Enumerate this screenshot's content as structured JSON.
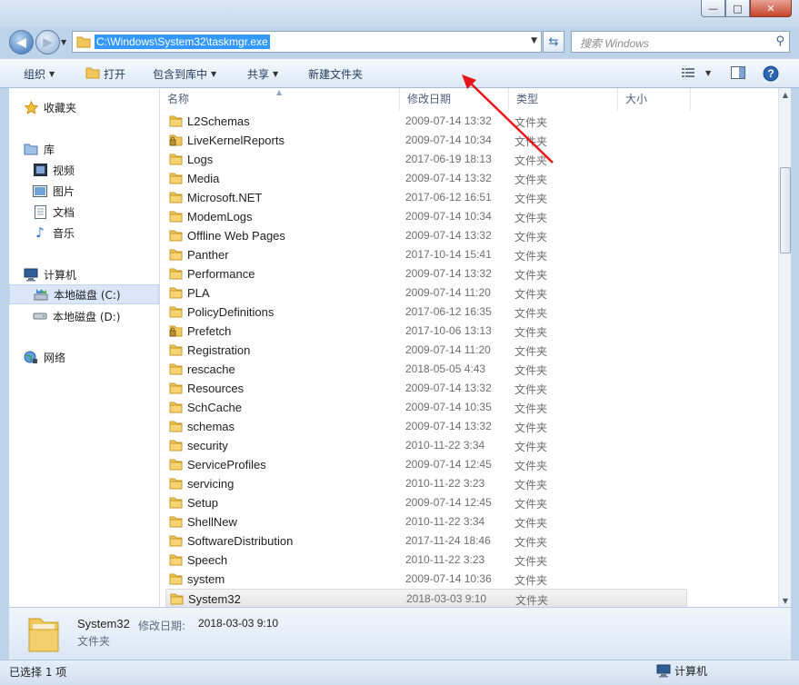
{
  "window": {
    "title_buttons": {
      "minimize": "—",
      "maximize": "□",
      "close": "✕"
    }
  },
  "address": {
    "path": "C:\\Windows\\System32\\taskmgr.exe",
    "search_placeholder": "搜索 Windows"
  },
  "toolbar": {
    "organize": "组织",
    "open": "打开",
    "include_library": "包含到库中",
    "share": "共享",
    "new_folder": "新建文件夹"
  },
  "nav": {
    "favorites": "收藏夹",
    "libraries": "库",
    "videos": "视频",
    "pictures": "图片",
    "documents": "文档",
    "music": "音乐",
    "computer": "计算机",
    "local_c": "本地磁盘 (C:)",
    "local_d": "本地磁盘 (D:)",
    "network": "网络"
  },
  "columns": {
    "name": "名称",
    "modified": "修改日期",
    "type": "类型",
    "size": "大小"
  },
  "files": [
    {
      "name": "L2Schemas",
      "date": "2009-07-14 13:32",
      "type": "文件夹",
      "locked": false
    },
    {
      "name": "LiveKernelReports",
      "date": "2009-07-14 10:34",
      "type": "文件夹",
      "locked": true
    },
    {
      "name": "Logs",
      "date": "2017-06-19 18:13",
      "type": "文件夹",
      "locked": false
    },
    {
      "name": "Media",
      "date": "2009-07-14 13:32",
      "type": "文件夹",
      "locked": false
    },
    {
      "name": "Microsoft.NET",
      "date": "2017-06-12 16:51",
      "type": "文件夹",
      "locked": false
    },
    {
      "name": "ModemLogs",
      "date": "2009-07-14 10:34",
      "type": "文件夹",
      "locked": false
    },
    {
      "name": "Offline Web Pages",
      "date": "2009-07-14 13:32",
      "type": "文件夹",
      "locked": false
    },
    {
      "name": "Panther",
      "date": "2017-10-14 15:41",
      "type": "文件夹",
      "locked": false
    },
    {
      "name": "Performance",
      "date": "2009-07-14 13:32",
      "type": "文件夹",
      "locked": false
    },
    {
      "name": "PLA",
      "date": "2009-07-14 11:20",
      "type": "文件夹",
      "locked": false
    },
    {
      "name": "PolicyDefinitions",
      "date": "2017-06-12 16:35",
      "type": "文件夹",
      "locked": false
    },
    {
      "name": "Prefetch",
      "date": "2017-10-06 13:13",
      "type": "文件夹",
      "locked": true
    },
    {
      "name": "Registration",
      "date": "2009-07-14 11:20",
      "type": "文件夹",
      "locked": false
    },
    {
      "name": "rescache",
      "date": "2018-05-05 4:43",
      "type": "文件夹",
      "locked": false
    },
    {
      "name": "Resources",
      "date": "2009-07-14 13:32",
      "type": "文件夹",
      "locked": false
    },
    {
      "name": "SchCache",
      "date": "2009-07-14 10:35",
      "type": "文件夹",
      "locked": false
    },
    {
      "name": "schemas",
      "date": "2009-07-14 13:32",
      "type": "文件夹",
      "locked": false
    },
    {
      "name": "security",
      "date": "2010-11-22 3:34",
      "type": "文件夹",
      "locked": false
    },
    {
      "name": "ServiceProfiles",
      "date": "2009-07-14 12:45",
      "type": "文件夹",
      "locked": false
    },
    {
      "name": "servicing",
      "date": "2010-11-22 3:23",
      "type": "文件夹",
      "locked": false
    },
    {
      "name": "Setup",
      "date": "2009-07-14 12:45",
      "type": "文件夹",
      "locked": false
    },
    {
      "name": "ShellNew",
      "date": "2010-11-22 3:34",
      "type": "文件夹",
      "locked": false
    },
    {
      "name": "SoftwareDistribution",
      "date": "2017-11-24 18:46",
      "type": "文件夹",
      "locked": false
    },
    {
      "name": "Speech",
      "date": "2010-11-22 3:23",
      "type": "文件夹",
      "locked": false
    },
    {
      "name": "system",
      "date": "2009-07-14 10:36",
      "type": "文件夹",
      "locked": false
    },
    {
      "name": "System32",
      "date": "2018-03-03 9:10",
      "type": "文件夹",
      "locked": false,
      "selected": true
    }
  ],
  "details": {
    "name": "System32",
    "modified_label": "修改日期:",
    "modified_value": "2018-03-03 9:10",
    "type": "文件夹"
  },
  "status": {
    "count": "已选择 1 项",
    "location": "计算机"
  },
  "colors": {
    "folder": "#f1c75b",
    "selection": "#3399ff",
    "annotation_arrow": "#e8141c"
  }
}
